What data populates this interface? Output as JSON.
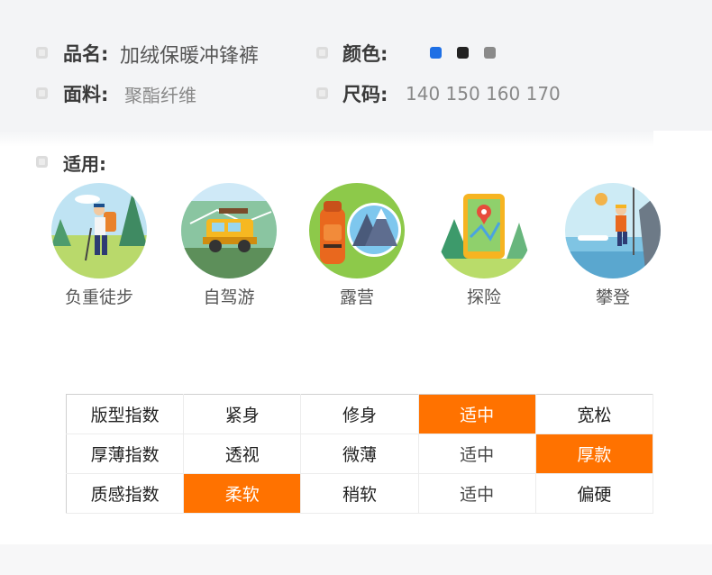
{
  "product": {
    "name_label": "品名:",
    "name_value": "加绒保暖冲锋裤",
    "color_label": "颜色:",
    "colors": [
      "#1e6fe5",
      "#222222",
      "#8a8a8a"
    ],
    "fabric_label": "面料:",
    "fabric_value": "聚酯纤维",
    "size_label": "尺码:",
    "size_value": "140 150 160 170"
  },
  "usage": {
    "label": "适用:",
    "items": [
      {
        "label": "负重徒步",
        "icon": "hiker-icon"
      },
      {
        "label": "自驾游",
        "icon": "jeep-icon"
      },
      {
        "label": "露营",
        "icon": "backpack-mountain-icon"
      },
      {
        "label": "探险",
        "icon": "map-pin-icon"
      },
      {
        "label": "攀登",
        "icon": "climber-icon"
      }
    ]
  },
  "index_table": {
    "accent": "#ff7200",
    "rows": [
      {
        "name": "版型指数",
        "options": [
          "紧身",
          "修身",
          "适中",
          "宽松"
        ],
        "selected": 2
      },
      {
        "name": "厚薄指数",
        "options": [
          "透视",
          "微薄",
          "适中",
          "厚款"
        ],
        "selected": 3
      },
      {
        "name": "质感指数",
        "options": [
          "柔软",
          "稍软",
          "适中",
          "偏硬"
        ],
        "selected": 0
      }
    ]
  }
}
